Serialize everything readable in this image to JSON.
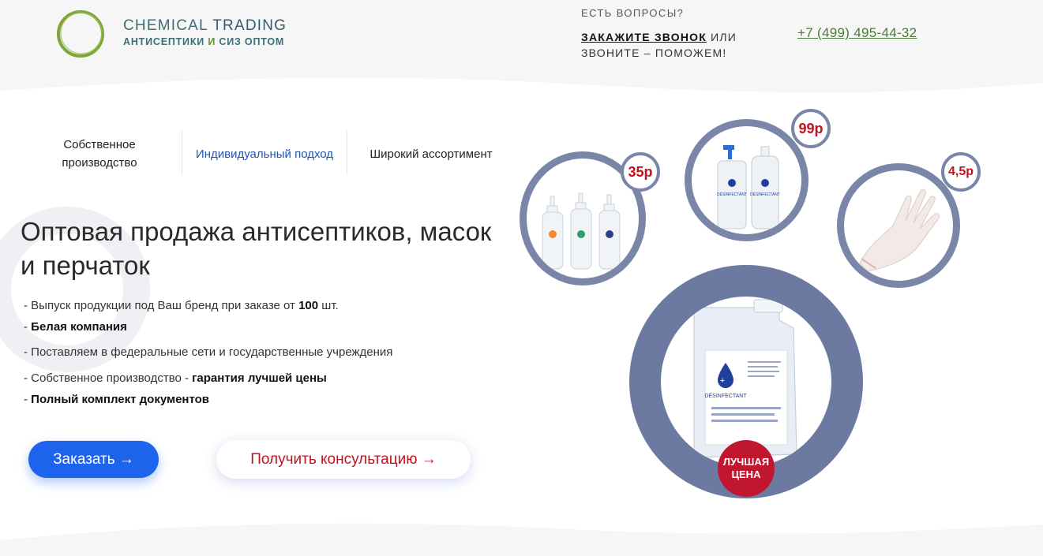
{
  "header": {
    "brand": {
      "word1": "CHEMICAL",
      "word2": "TRADING",
      "sub_main": "АНТИСЕПТИКИ",
      "sub_conj": "И",
      "sub_rest": "СИЗ ОПТОМ"
    },
    "questions": "ЕСТЬ ВОПРОСЫ?",
    "callback_link": "ЗАКАЖИТЕ ЗВОНОК",
    "callback_or": " ИЛИ",
    "callback_rest": "ЗВОНИТЕ – ПОМОЖЕМ!",
    "phone": "+7 (499) 495-44-32"
  },
  "features": [
    {
      "label": "Собственное производство"
    },
    {
      "label": "Индивидуальный подход"
    },
    {
      "label": "Широкий ассортимент"
    }
  ],
  "hero": {
    "headline": "Оптовая продажа антисептиков, масок и перчаток",
    "bullets": [
      {
        "pre": "- Выпуск продукции под Ваш бренд при заказе от ",
        "bold": "100",
        "post": " шт."
      },
      {
        "pre": "- ",
        "bold": "Белая компания",
        "post": ""
      },
      {
        "pre": "-  Поставляем в федеральные сети и государственные учреждения",
        "bold": "",
        "post": ""
      },
      {
        "pre": "- Собственное производство - ",
        "bold": "гарантия лучшей цены",
        "post": ""
      },
      {
        "pre": "- ",
        "bold": "Полный комплект документов",
        "post": ""
      }
    ],
    "order_button": "Заказать →",
    "consult_button": "Получить консультацию →"
  },
  "products": {
    "prices": [
      "35р",
      "99р",
      "4,5р"
    ],
    "label_text": "DÉSINFECTANT",
    "best_price": [
      "ЛУЧШАЯ",
      "ЦЕНА"
    ]
  },
  "colors": {
    "accent_blue": "#1d63ec",
    "accent_red": "#c0121f",
    "ring": "#7a86a8",
    "brand_teal": "#3a6f76",
    "phone_green": "#4d7a3a"
  }
}
